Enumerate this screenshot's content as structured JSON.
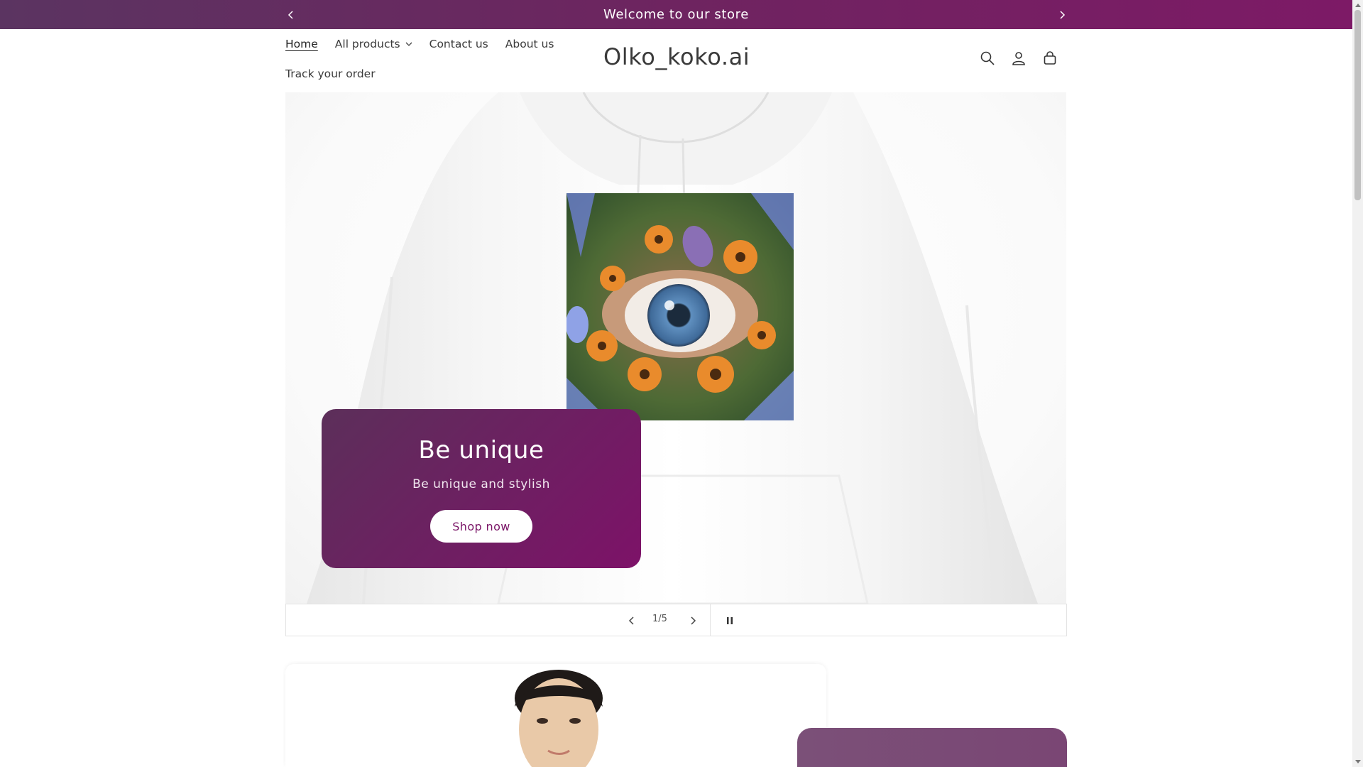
{
  "announcement": {
    "message": "Welcome to our store",
    "prev_icon": "chevron-left-icon",
    "next_icon": "chevron-right-icon"
  },
  "header": {
    "logo": "Olko_koko.ai",
    "nav": [
      {
        "label": "Home",
        "active": true
      },
      {
        "label": "All products",
        "has_dropdown": true
      },
      {
        "label": "Contact us"
      },
      {
        "label": "About us"
      },
      {
        "label": "Track your order"
      }
    ],
    "icons": [
      "search-icon",
      "account-icon",
      "cart-icon"
    ]
  },
  "hero": {
    "heading": "Be unique",
    "subheading": "Be unique and stylish",
    "button_label": "Shop now"
  },
  "slider": {
    "counter": "1/5",
    "controls": [
      "chevron-left-icon",
      "chevron-right-icon",
      "pause-icon"
    ]
  },
  "colors": {
    "brand_purple": "#6e2460",
    "brand_magenta": "#7d1268",
    "button_text": "#7a1466"
  }
}
